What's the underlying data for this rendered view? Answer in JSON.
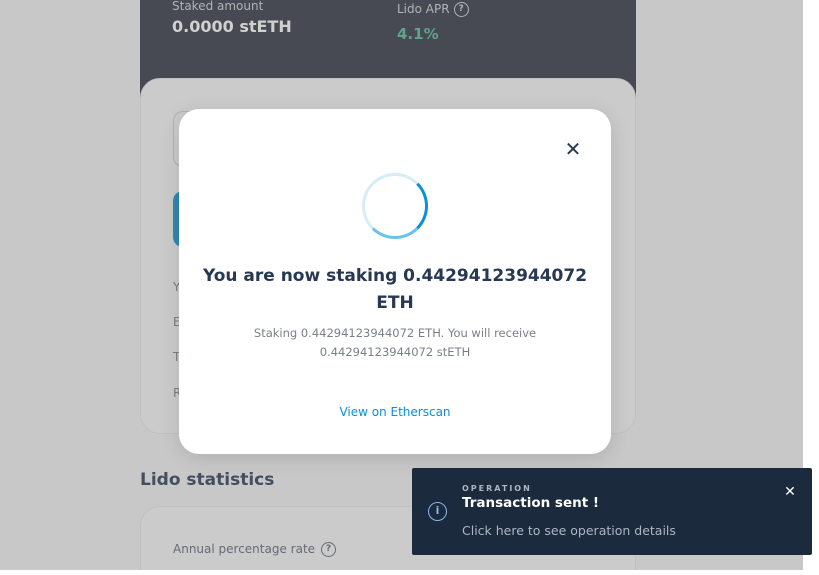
{
  "stats": {
    "staked_label": "Staked amount",
    "staked_value": "0.0000 stETH",
    "apr_label": "Lido APR",
    "apr_value": "4.1%",
    "help_glyph": "?"
  },
  "form": {
    "row_initials": [
      "Y",
      "E",
      "T",
      "R"
    ]
  },
  "lido_statistics": {
    "title": "Lido statistics",
    "apr_label": "Annual percentage rate",
    "help_glyph": "?"
  },
  "modal": {
    "close_glyph": "✕",
    "title": "You are now staking 0.44294123944072 ETH",
    "description": "Staking 0.44294123944072 ETH. You will receive 0.44294123944072 stETH",
    "link": "View on Etherscan"
  },
  "toast": {
    "kicker": "OPERATION",
    "title": "Transaction sent !",
    "description": "Click here to see operation details",
    "info_glyph": "i",
    "close_glyph": "✕"
  },
  "colors": {
    "accent": "#0a8fd8",
    "apr_green": "#53ba95",
    "dark_card": "#2d323f",
    "toast_bg": "#1b2a3c"
  }
}
